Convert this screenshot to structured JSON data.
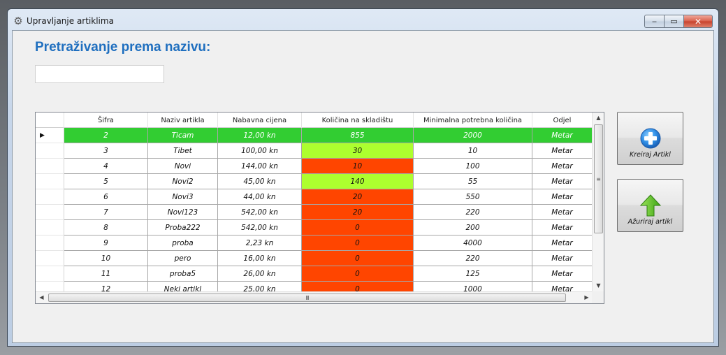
{
  "window": {
    "title": "Upravljanje artiklima",
    "controls": {
      "minimize": "‒",
      "maximize": "▭",
      "close": "✕"
    }
  },
  "main": {
    "heading": "Pretraživanje prema nazivu:",
    "search": {
      "value": "",
      "placeholder": ""
    }
  },
  "grid": {
    "columns": [
      "Šifra",
      "Naziv artikla",
      "Nabavna cijena",
      "Količina na skladištu",
      "Minimalna potrebna količina",
      "Odjel"
    ],
    "selected_row_indicator": "▶",
    "rows": [
      {
        "sifra": "2",
        "naziv": "Ticam",
        "cijena": "12,00 kn",
        "kolicina": "855",
        "min": "2000",
        "odjel": "Metar",
        "status": "selected"
      },
      {
        "sifra": "3",
        "naziv": "Tibet",
        "cijena": "100,00 kn",
        "kolicina": "30",
        "min": "10",
        "odjel": "Metar",
        "status": "green"
      },
      {
        "sifra": "4",
        "naziv": "Novi",
        "cijena": "144,00 kn",
        "kolicina": "10",
        "min": "100",
        "odjel": "Metar",
        "status": "red"
      },
      {
        "sifra": "5",
        "naziv": "Novi2",
        "cijena": "45,00 kn",
        "kolicina": "140",
        "min": "55",
        "odjel": "Metar",
        "status": "green"
      },
      {
        "sifra": "6",
        "naziv": "Novi3",
        "cijena": "44,00 kn",
        "kolicina": "20",
        "min": "550",
        "odjel": "Metar",
        "status": "red"
      },
      {
        "sifra": "7",
        "naziv": "Novi123",
        "cijena": "542,00 kn",
        "kolicina": "20",
        "min": "220",
        "odjel": "Metar",
        "status": "red"
      },
      {
        "sifra": "8",
        "naziv": "Proba222",
        "cijena": "542,00 kn",
        "kolicina": "0",
        "min": "200",
        "odjel": "Metar",
        "status": "red"
      },
      {
        "sifra": "9",
        "naziv": "proba",
        "cijena": "2,23 kn",
        "kolicina": "0",
        "min": "4000",
        "odjel": "Metar",
        "status": "red"
      },
      {
        "sifra": "10",
        "naziv": "pero",
        "cijena": "16,00 kn",
        "kolicina": "0",
        "min": "220",
        "odjel": "Metar",
        "status": "red"
      },
      {
        "sifra": "11",
        "naziv": "proba5",
        "cijena": "26,00 kn",
        "kolicina": "0",
        "min": "125",
        "odjel": "Metar",
        "status": "red"
      },
      {
        "sifra": "12",
        "naziv": "Neki artikl",
        "cijena": "25,00 kn",
        "kolicina": "0",
        "min": "1000",
        "odjel": "Metar",
        "status": "red"
      }
    ],
    "scroll": {
      "up": "▲",
      "down": "▼",
      "left": "◀",
      "right": "▶",
      "v_grip": "≡",
      "h_grip": "III"
    }
  },
  "actions": {
    "create_label": "Kreiraj Artikl",
    "update_label": "Ažuriraj artikl"
  },
  "colors": {
    "selected_row": "#32cd32",
    "qty_ok": "#adff2f",
    "qty_low": "#ff4500",
    "heading": "#1f6fbf"
  },
  "icons": [
    "gear-icon",
    "plus-circle-icon",
    "up-arrow-icon"
  ]
}
